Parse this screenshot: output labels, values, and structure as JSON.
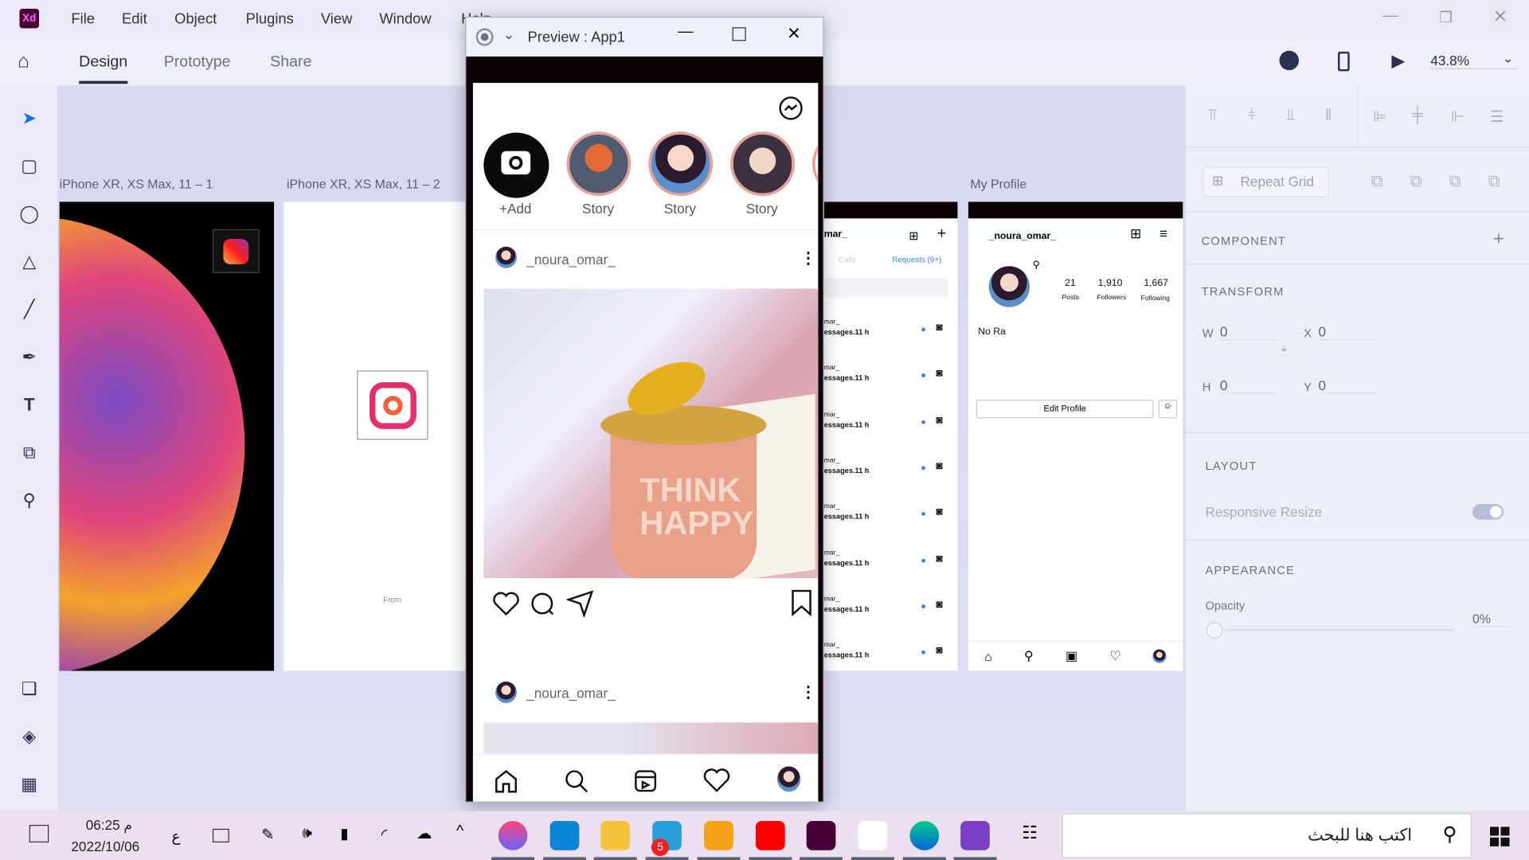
{
  "app": {
    "logo": "Xd",
    "menus": [
      "File",
      "Edit",
      "Object",
      "Plugins",
      "View",
      "Window",
      "Help"
    ]
  },
  "toolbar": {
    "tabs": [
      "Design",
      "Prototype",
      "Share"
    ],
    "active_tab": "Design",
    "zoom": "43.8%"
  },
  "tools": [
    "select-icon",
    "rectangle-icon",
    "ellipse-icon",
    "triangle-icon",
    "line-icon",
    "pen-icon",
    "text-icon",
    "artboard-icon",
    "zoom-icon",
    "assets-icon",
    "layers-icon",
    "plugins-icon"
  ],
  "artboards": {
    "a1": "iPhone XR, XS Max, 11 – 1",
    "a2": "iPhone XR, XS Max, 11 – 2",
    "a2_text": "From",
    "a4": "My Profile"
  },
  "messages": {
    "user": "mar_",
    "calls": "Calls",
    "requests": "Requests (9+)",
    "rows": [
      {
        "name": "mar_",
        "meta": "essages.11 h"
      },
      {
        "name": "mar_",
        "meta": "essages.11 h"
      },
      {
        "name": "mar_",
        "meta": "essages.11 h"
      },
      {
        "name": "mar_",
        "meta": "essages.11 h"
      },
      {
        "name": "mar_",
        "meta": "essages.11 h"
      },
      {
        "name": "mar_",
        "meta": "essages.11 h"
      },
      {
        "name": "mar_",
        "meta": "essages.11 h"
      },
      {
        "name": "mar_",
        "meta": "essages.11 h"
      }
    ],
    "accent": "#3b82f6"
  },
  "profile": {
    "username": "_noura_omar_",
    "posts": "21",
    "posts_label": "Posts",
    "followers": "1,910",
    "followers_label": "Followers",
    "following": "1,667",
    "following_label": "Following",
    "name": "No Ra",
    "edit": "Edit Profile"
  },
  "preview": {
    "title": "Preview : App1",
    "stories": [
      "+Add",
      "Story",
      "Story",
      "Story"
    ],
    "post_user": "_noura_omar_",
    "post_user2": "_noura_omar_",
    "mug_text": "THINK HAPPY",
    "story_ring": "#e3a39a"
  },
  "panel": {
    "repeat_grid": "Repeat Grid",
    "component": "COMPONENT",
    "transform": "TRANSFORM",
    "w_label": "W",
    "w": "0",
    "x_label": "X",
    "x": "0",
    "h_label": "H",
    "h": "0",
    "y_label": "Y",
    "y": "0",
    "layout": "LAYOUT",
    "responsive": "Responsive Resize",
    "responsive_on": true,
    "appearance": "APPEARANCE",
    "opacity_label": "Opacity",
    "opacity": "0%"
  },
  "taskbar": {
    "time": "06:25 م",
    "date": "2022/10/06",
    "lang": "ع",
    "search_placeholder": "اكتب هنا للبحث",
    "telegram_badge": "5",
    "apps": [
      "paint",
      "cortana",
      "explorer",
      "telegram",
      "app5",
      "youtube",
      "xd",
      "app-face",
      "edge",
      "visual-studio"
    ]
  }
}
